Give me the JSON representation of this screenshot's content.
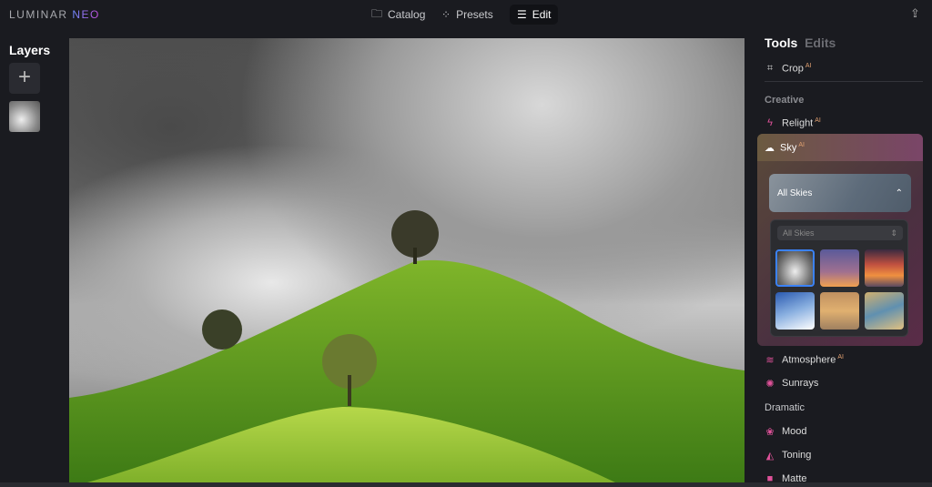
{
  "app": {
    "logo_main": "LUMINAR",
    "logo_accent": "NEO"
  },
  "nav": [
    {
      "label": "Catalog",
      "icon": "folder-icon"
    },
    {
      "label": "Presets",
      "icon": "magic-wand-icon"
    },
    {
      "label": "Edit",
      "icon": "sliders-icon",
      "active": true
    }
  ],
  "layers": {
    "title": "Layers",
    "add": "+"
  },
  "panel": {
    "tabs": [
      "Tools",
      "Edits"
    ],
    "active_tab": "Tools",
    "crop": {
      "label": "Crop",
      "badge": "AI"
    },
    "creative_title": "Creative",
    "relight": {
      "label": "Relight",
      "badge": "AI"
    },
    "sky": {
      "label": "Sky",
      "badge": "AI",
      "dropdown": "All Skies",
      "filter": "All Skies",
      "selected_thumb": 0
    },
    "atmosphere": {
      "label": "Atmosphere",
      "badge": "AI"
    },
    "sunrays": {
      "label": "Sunrays"
    },
    "dramatic_title": "Dramatic",
    "mood": {
      "label": "Mood"
    },
    "toning": {
      "label": "Toning"
    },
    "matte": {
      "label": "Matte"
    }
  },
  "colors": {
    "accent": "#e0529a",
    "selection": "#3b82f6"
  }
}
